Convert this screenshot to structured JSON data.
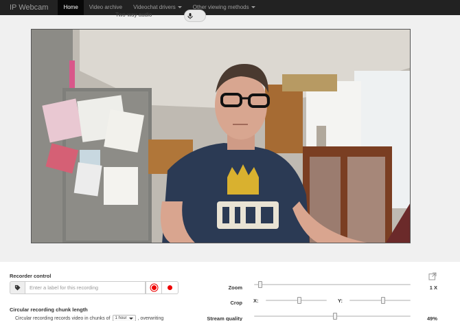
{
  "navbar": {
    "brand": "IP Webcam",
    "items": [
      {
        "label": "Home",
        "active": true,
        "dropdown": false
      },
      {
        "label": "Video archive",
        "active": false,
        "dropdown": false
      },
      {
        "label": "Videochat drivers",
        "active": false,
        "dropdown": true
      },
      {
        "label": "Other viewing methods",
        "active": false,
        "dropdown": true
      }
    ]
  },
  "two_way_audio": {
    "label": "Two-way audio",
    "icon": "microphone-icon",
    "enabled": false
  },
  "video": {
    "alt": "Live camera stream"
  },
  "recorder": {
    "title": "Recorder control",
    "label_placeholder": "Enter a label for this recording",
    "tag_icon": "tag-icon"
  },
  "chunk": {
    "title": "Circular recording chunk length",
    "prefix": "Circular recording records video in chunks of",
    "selected": "1 hour",
    "suffix": ", overwriting"
  },
  "controls": {
    "zoom": {
      "label": "Zoom",
      "value": "1 X",
      "level": 0.0
    },
    "crop": {
      "label": "Crop",
      "x_label": "X:",
      "y_label": "Y:",
      "x_level": 0.5,
      "y_level": 0.5
    },
    "stream_quality": {
      "label": "Stream quality",
      "value": "49%",
      "level": 0.49
    }
  },
  "colors": {
    "navbar_bg": "#222222",
    "active_tab_bg": "#080808",
    "record_red": "#ee0000"
  }
}
